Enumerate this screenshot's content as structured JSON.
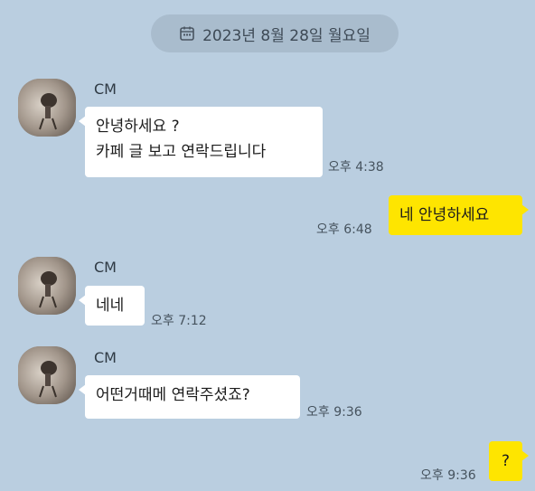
{
  "date_divider": {
    "icon": "calendar-icon",
    "label": "2023년 8월 28일 월요일"
  },
  "messages": [
    {
      "sender": "CM",
      "text": "안녕하세요 ?\n카페 글 보고 연락드립니다",
      "time": "오후 4:38",
      "direction": "incoming"
    },
    {
      "text": "네 안녕하세요",
      "time": "오후 6:48",
      "direction": "outgoing"
    },
    {
      "sender": "CM",
      "text": "네네",
      "time": "오후 7:12",
      "direction": "incoming"
    },
    {
      "sender": "CM",
      "text": "어떤거때메 연락주셨죠?",
      "time": "오후 9:36",
      "direction": "incoming"
    },
    {
      "text": "?",
      "time": "오후 9:36",
      "direction": "outgoing"
    }
  ],
  "colors": {
    "background": "#bacee0",
    "outgoing_bubble": "#fee500",
    "incoming_bubble": "#ffffff",
    "date_pill": "#a9bccd"
  }
}
